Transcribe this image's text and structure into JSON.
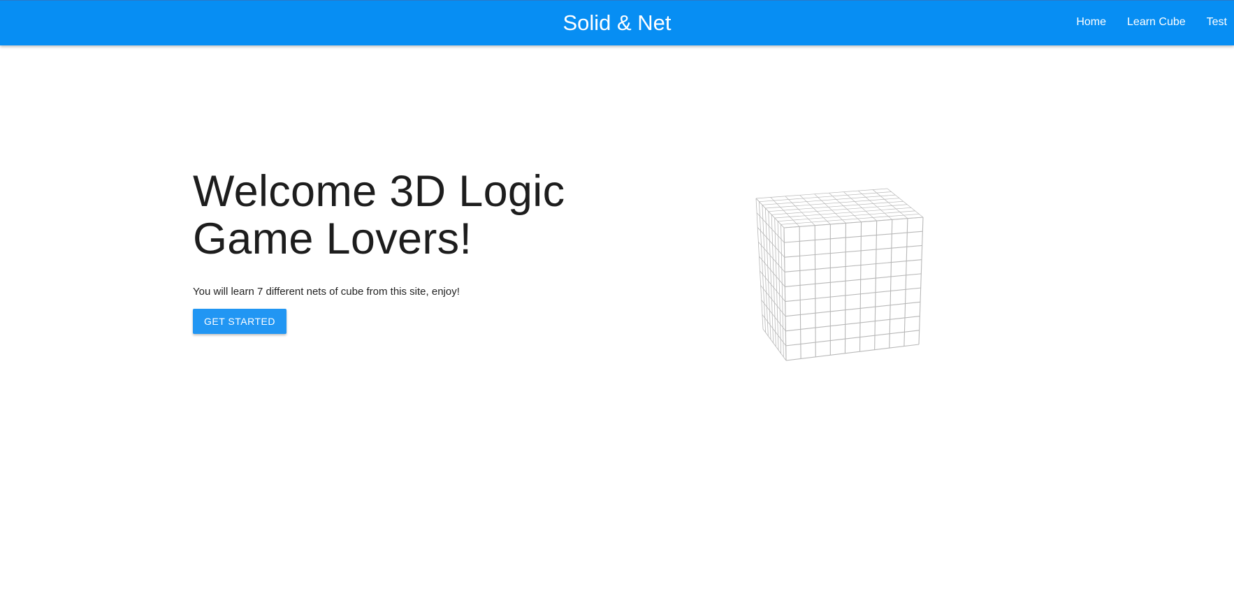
{
  "appbar": {
    "title": "Solid & Net",
    "nav": [
      {
        "label": "Home"
      },
      {
        "label": "Learn Cube"
      },
      {
        "label": "Test"
      }
    ],
    "color": "#078ef3"
  },
  "hero": {
    "title_line1": "Welcome 3D Logic",
    "title_line2": "Game Lovers!",
    "subtitle": "You will learn 7 different nets of cube from this site, enjoy!",
    "cta_label": "GET STARTED",
    "cta_color": "#2196f3"
  },
  "illustration": {
    "name": "wireframe-cube",
    "grid_divisions": 9,
    "line_color": "#b8b8b8"
  }
}
